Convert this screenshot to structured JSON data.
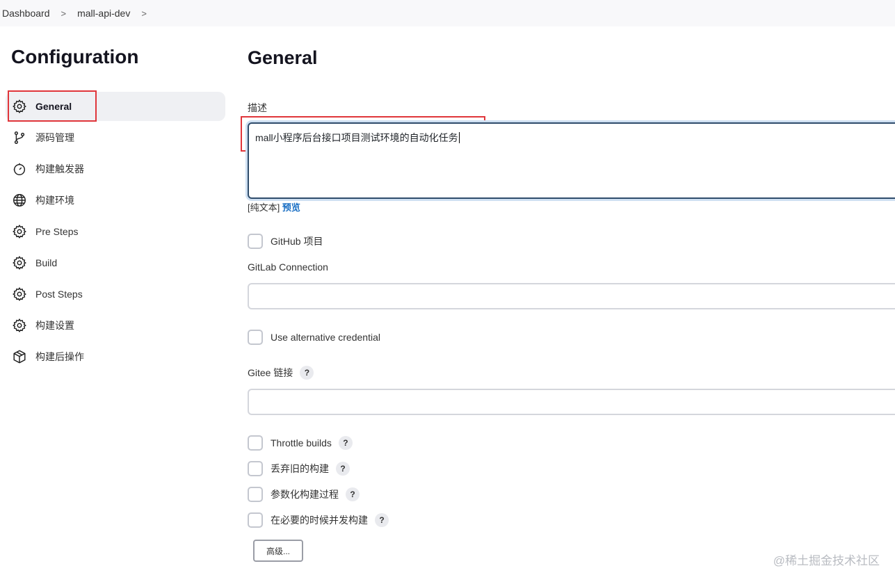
{
  "breadcrumb": {
    "items": [
      "Dashboard",
      "mall-api-dev"
    ],
    "separator": ">"
  },
  "sidebar": {
    "title": "Configuration",
    "items": [
      {
        "label": "General",
        "icon": "gear-icon",
        "active": true
      },
      {
        "label": "源码管理",
        "icon": "branch-icon"
      },
      {
        "label": "构建触发器",
        "icon": "timer-icon"
      },
      {
        "label": "构建环境",
        "icon": "globe-icon"
      },
      {
        "label": "Pre Steps",
        "icon": "gear-icon"
      },
      {
        "label": "Build",
        "icon": "gear-icon"
      },
      {
        "label": "Post Steps",
        "icon": "gear-icon"
      },
      {
        "label": "构建设置",
        "icon": "gear-icon"
      },
      {
        "label": "构建后操作",
        "icon": "package-icon"
      }
    ]
  },
  "main": {
    "title": "General",
    "description": {
      "label": "描述",
      "value": "mall小程序后台接口项目测试环境的自动化任务",
      "plain_text_note": "[纯文本]",
      "preview_link": "预览"
    },
    "github_project": {
      "label": "GitHub 项目",
      "checked": false
    },
    "gitlab_connection": {
      "label": "GitLab Connection",
      "value": ""
    },
    "alt_credential": {
      "label": "Use alternative credential",
      "checked": false
    },
    "gitee_link": {
      "label": "Gitee 链接",
      "help": "?",
      "value": ""
    },
    "options": [
      {
        "label": "Throttle builds",
        "help": "?",
        "checked": false
      },
      {
        "label": "丢弃旧的构建",
        "help": "?",
        "checked": false
      },
      {
        "label": "参数化构建过程",
        "help": "?",
        "checked": false
      },
      {
        "label": "在必要的时候并发构建",
        "help": "?",
        "checked": false
      }
    ],
    "advanced_button": "高级..."
  },
  "watermark": "@稀土掘金技术社区",
  "colors": {
    "highlight_box": "#e0353a",
    "link": "#1a6fc4",
    "active_nav_bg": "#eff0f3",
    "focused_border": "#2f4c6b"
  }
}
